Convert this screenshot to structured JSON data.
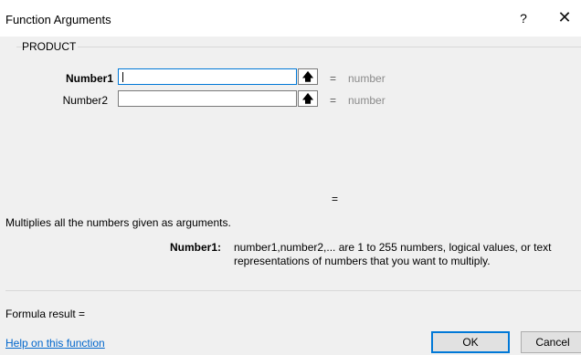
{
  "window": {
    "title": "Function Arguments",
    "help_glyph": "?",
    "close_glyph": "✕"
  },
  "function_name": "PRODUCT",
  "arguments": [
    {
      "label": "Number1",
      "value": "",
      "result_eq": "=",
      "result_placeholder": "number"
    },
    {
      "label": "Number2",
      "value": "",
      "result_eq": "=",
      "result_placeholder": "number"
    }
  ],
  "collapse_icon": "arrow-up-icon",
  "function_result_eq": "=",
  "description": "Multiplies all the numbers given as arguments.",
  "arg_help": {
    "name": "Number1:",
    "line1": "number1,number2,... are 1 to 255 numbers, logical values, or text",
    "line2": "representations of numbers that you want to multiply."
  },
  "formula_result": "Formula result =",
  "help_link": "Help on this function",
  "buttons": {
    "ok": "OK",
    "cancel": "Cancel"
  },
  "colors": {
    "accent": "#0078d7",
    "link": "#0066cc"
  }
}
